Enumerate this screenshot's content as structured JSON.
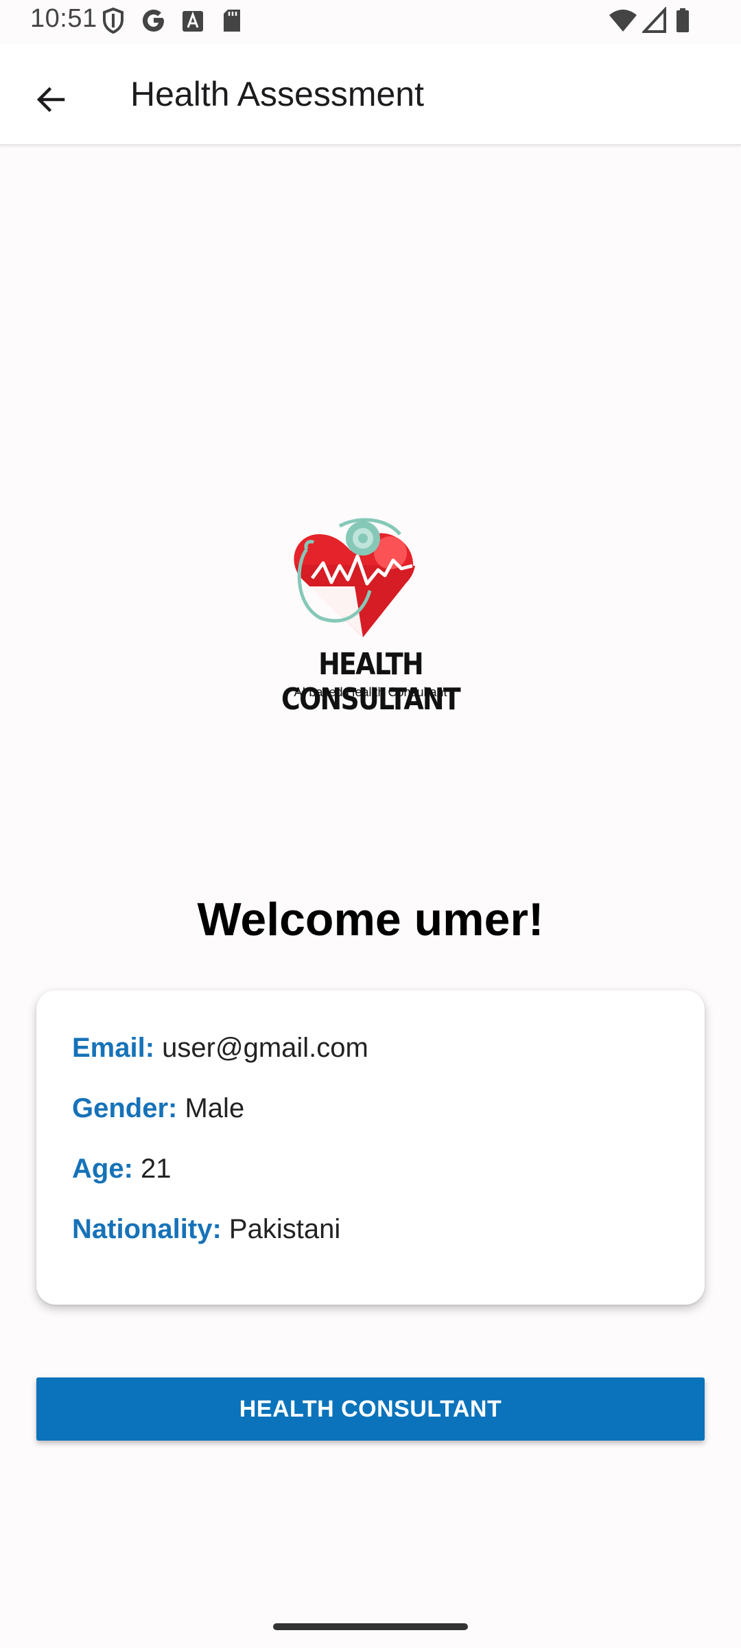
{
  "status_bar": {
    "time": "10:51",
    "left_icons": [
      "shield-icon",
      "google-icon",
      "font-a-icon",
      "sd-card-icon"
    ],
    "right_icons": [
      "wifi-icon",
      "cell-signal-icon",
      "battery-icon"
    ]
  },
  "app_bar": {
    "title": "Health Assessment",
    "back_icon": "arrow-back-icon"
  },
  "logo": {
    "title": "HEALTH CONSULTANT",
    "subtitle": "AI based  Heallth Consultant",
    "colors": {
      "heart": "#e5232a",
      "stethoscope": "#86c8b8"
    }
  },
  "welcome": "Welcome umer!",
  "profile": [
    {
      "label": "Email:",
      "value": "user@gmail.com"
    },
    {
      "label": "Gender:",
      "value": "Male"
    },
    {
      "label": "Age:",
      "value": "21"
    },
    {
      "label": "Nationality:",
      "value": "Pakistani"
    }
  ],
  "button": {
    "label": "HEALTH CONSULTANT"
  },
  "colors": {
    "accent": "#0a73bb",
    "label_blue": "#1672b8"
  }
}
